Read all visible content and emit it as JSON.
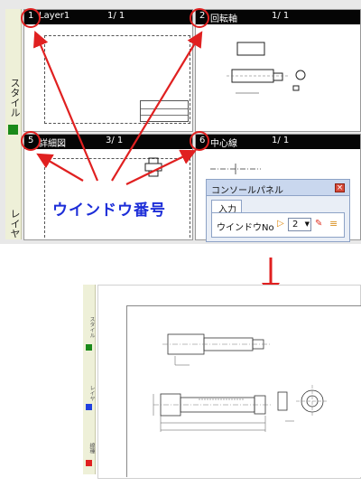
{
  "windows": [
    {
      "num": "1",
      "name": "Layer1",
      "page": "1/  1"
    },
    {
      "num": "2",
      "name": "回転軸",
      "page": "1/  1"
    },
    {
      "num": "5",
      "name": "詳細図",
      "page": "3/  1"
    },
    {
      "num": "6",
      "name": "中心線",
      "page": "1/  1"
    }
  ],
  "sidebar": {
    "style_tab": "スタイル",
    "layer_tab": "レイヤ"
  },
  "callout": {
    "text": "ウインドウ番号"
  },
  "console": {
    "title": "コンソールパネル",
    "tab": "入力",
    "row_label": "ウインドウNo",
    "window_no": "2"
  },
  "bottom_sidebar": {
    "labels": [
      "スタイル",
      "レイヤ",
      "線種"
    ]
  },
  "colors": {
    "accent_red": "#e02020",
    "callout_blue": "#1c2dd8",
    "titlebar": "#050505",
    "style_green": "#1a8a1a"
  },
  "icons": [
    "close-icon",
    "play-icon",
    "dropdown-arrow-icon",
    "pin-icon",
    "list-icon",
    "down-arrow-icon"
  ]
}
